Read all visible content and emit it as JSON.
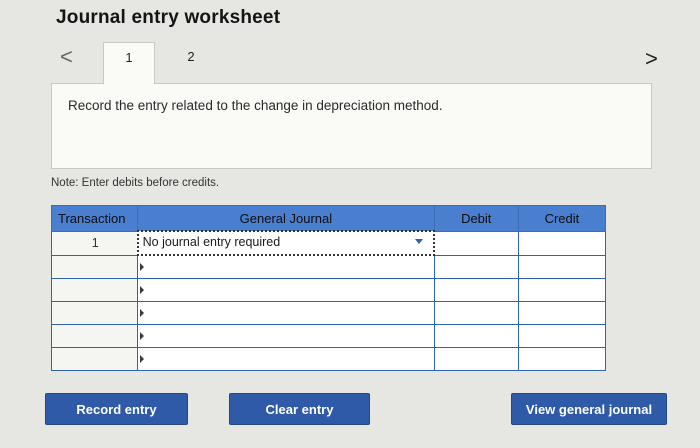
{
  "title": "Journal entry worksheet",
  "nav": {
    "prev_glyph": "<",
    "next_glyph": ">"
  },
  "tabs": [
    {
      "label": "1"
    },
    {
      "label": "2"
    }
  ],
  "instruction": "Record the entry related to the change in depreciation method.",
  "note": "Note: Enter debits before credits.",
  "table": {
    "headers": {
      "transaction": "Transaction",
      "general_journal": "General Journal",
      "debit": "Debit",
      "credit": "Credit"
    },
    "rows": [
      {
        "transaction": "1",
        "account": "No journal entry required",
        "debit": "",
        "credit": ""
      },
      {
        "transaction": "",
        "account": "",
        "debit": "",
        "credit": ""
      },
      {
        "transaction": "",
        "account": "",
        "debit": "",
        "credit": ""
      },
      {
        "transaction": "",
        "account": "",
        "debit": "",
        "credit": ""
      },
      {
        "transaction": "",
        "account": "",
        "debit": "",
        "credit": ""
      },
      {
        "transaction": "",
        "account": "",
        "debit": "",
        "credit": ""
      }
    ]
  },
  "buttons": {
    "record": "Record entry",
    "clear": "Clear entry",
    "view": "View general journal"
  },
  "colors": {
    "header_blue": "#4a7fd0",
    "button_blue": "#2e5aa8",
    "grid_blue": "#2e62b2"
  }
}
